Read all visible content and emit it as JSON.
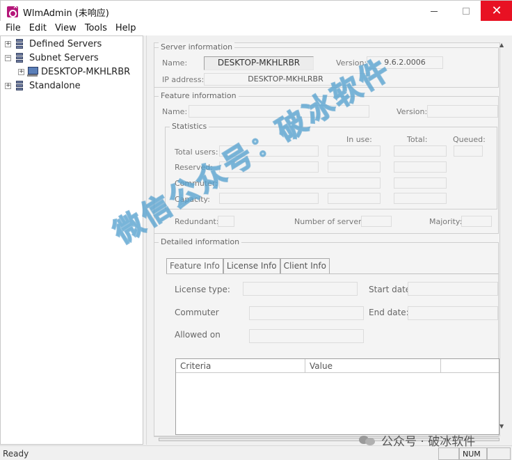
{
  "window": {
    "title": "WlmAdmin (未响应)",
    "minimize_glyph": "–",
    "close_glyph": "✕"
  },
  "menu": [
    "File",
    "Edit",
    "View",
    "Tools",
    "Help"
  ],
  "tree": {
    "defined_servers": "Defined Servers",
    "subnet_servers": "Subnet Servers",
    "desktop": "DESKTOP-MKHLRBR",
    "standalone": "Standalone"
  },
  "server_info": {
    "title": "Server information",
    "name_label": "Name:",
    "name_value": "DESKTOP-MKHLRBR",
    "version_label": "Version:",
    "version_value": "9.6.2.0006",
    "ip_label": "IP address:",
    "ip_value": "DESKTOP-MKHLRBR"
  },
  "feature_info": {
    "title": "Feature information",
    "name_label": "Name:",
    "version_label": "Version:",
    "statistics_title": "Statistics",
    "col_in_use": "In use:",
    "col_total": "Total:",
    "col_queued": "Queued:",
    "row_total_users": "Total users:",
    "row_reserved": "Reserved:",
    "row_commuter": "Commuter:",
    "row_capacity": "Capacity:",
    "redundant_label": "Redundant:",
    "num_servers_label": "Number of servers:",
    "majority_label": "Majority:"
  },
  "detailed_info": {
    "title": "Detailed information",
    "tabs": [
      "Feature Info",
      "License Info",
      "Client Info"
    ],
    "license_type_label": "License type:",
    "start_date_label": "Start date",
    "commuter_label": "Commuter",
    "end_date_label": "End date:",
    "allowed_on_label": "Allowed on",
    "columns": [
      "Criteria",
      "Value"
    ]
  },
  "status": {
    "text": "Ready",
    "num": "NUM"
  },
  "watermark": {
    "diagonal": "微信公众号：破冰软件",
    "corner": "公众号 · 破冰软件"
  }
}
